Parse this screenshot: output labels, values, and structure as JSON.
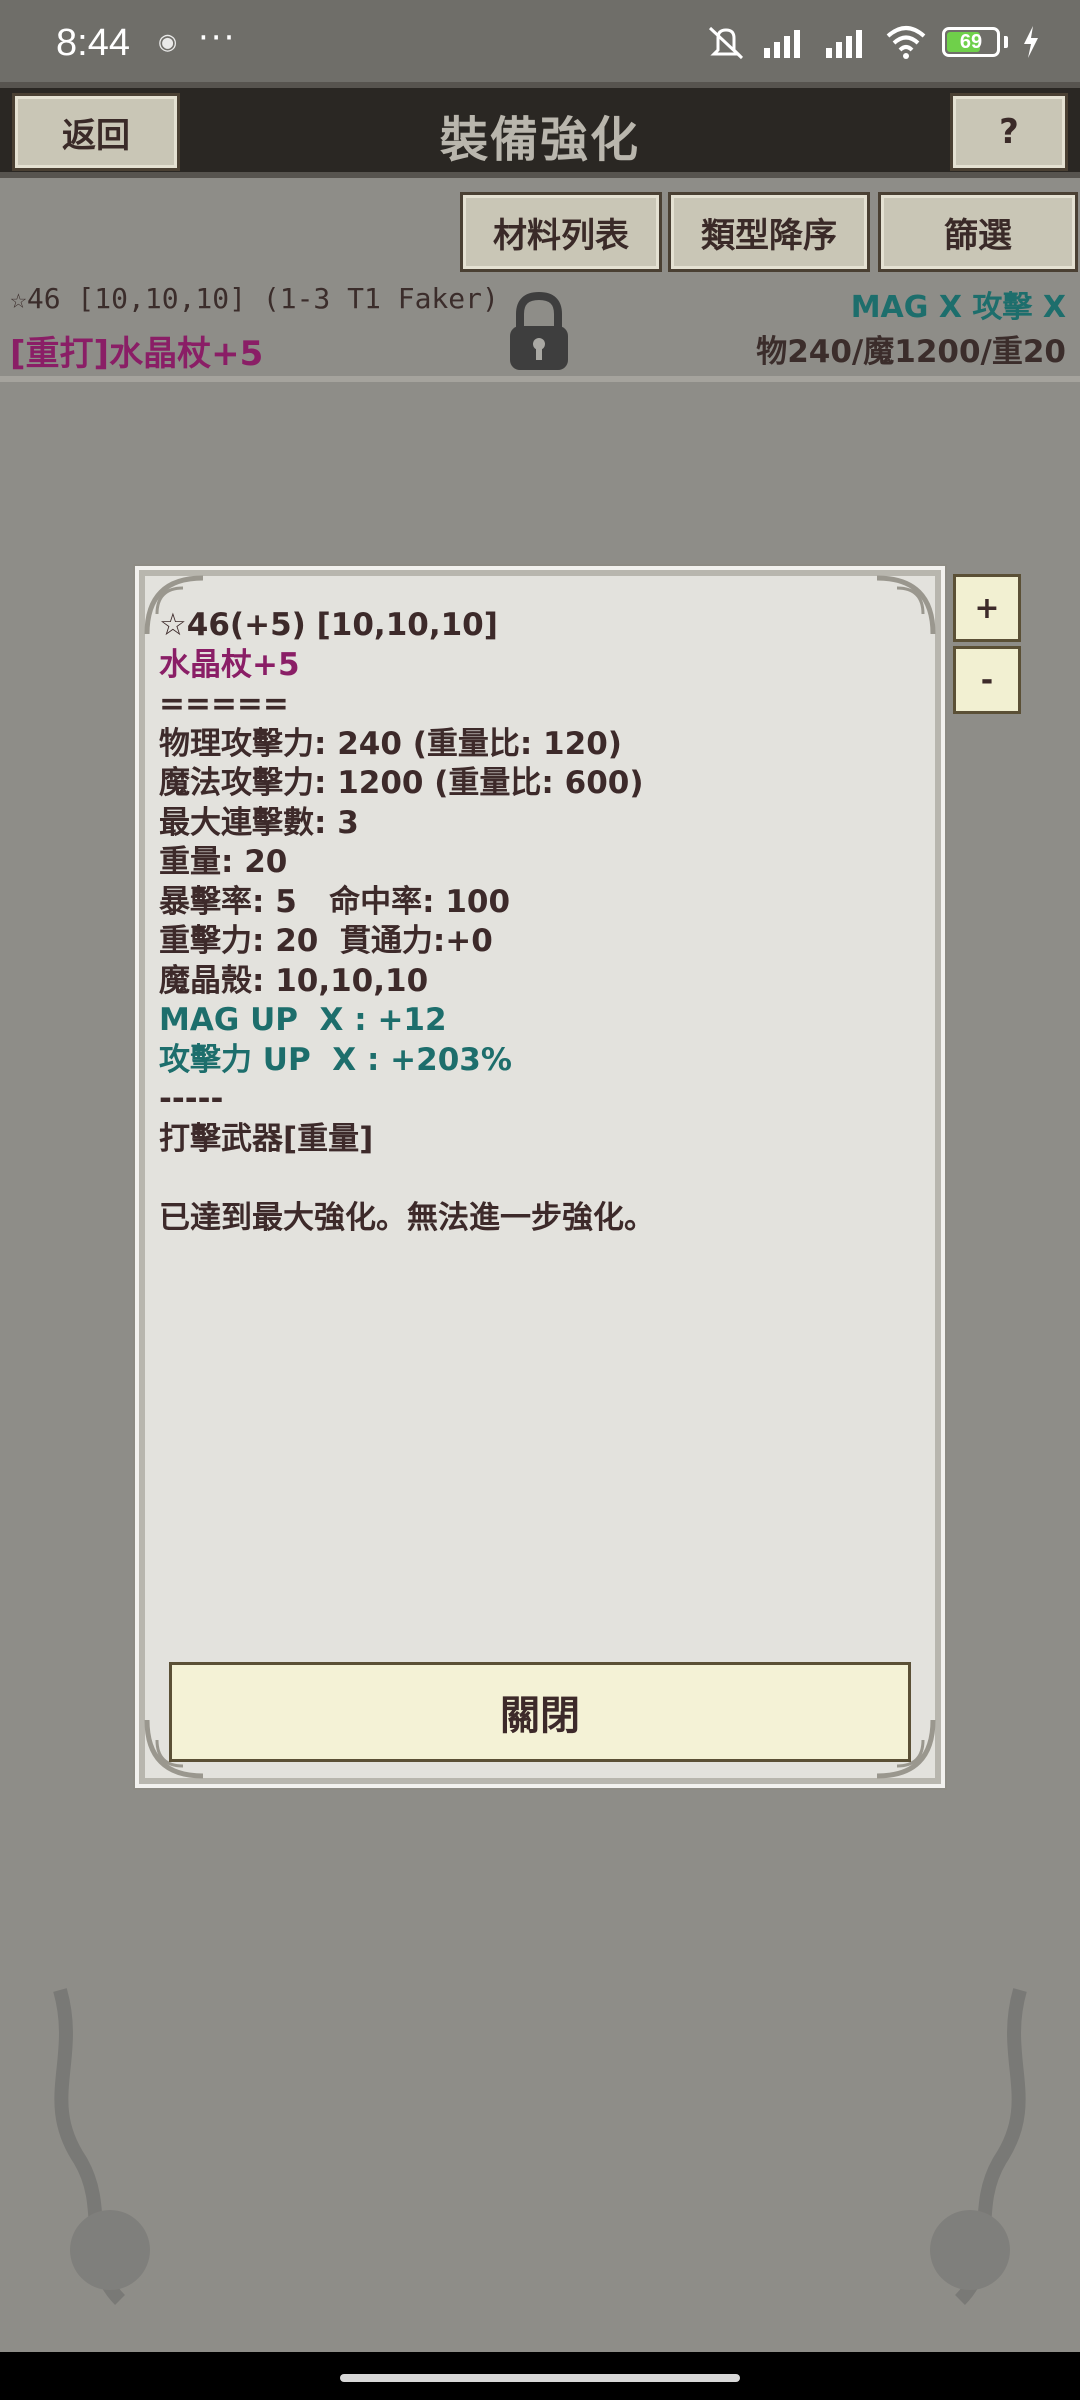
{
  "status_bar": {
    "time": "8:44",
    "misc": "◉",
    "dots": "···",
    "battery_level": "69",
    "battery_fraction": 0.69
  },
  "header": {
    "back_label": "返回",
    "title": "裝備強化",
    "help_label": "?"
  },
  "filters": {
    "materials_label": "材料列表",
    "sort_label": "類型降序",
    "filter_label": "篩選"
  },
  "item": {
    "info_line": "☆46 [10,10,10] (1-3 T1 Faker)",
    "name": "[重打]水晶杖+5",
    "bonus_tags": "MAG X  攻擊 X",
    "stats": "物240/魔1200/重20"
  },
  "dialog": {
    "lines": {
      "l0": "☆46(+5) [10,10,10]",
      "l1": "水晶杖+5",
      "l2": "=====",
      "l3": "物理攻擊力: 240 (重量比: 120)",
      "l4": "魔法攻擊力: 1200 (重量比: 600)",
      "l5": "最大連擊數: 3",
      "l6": "重量: 20",
      "l7": "暴擊率: 5   命中率: 100",
      "l8": "重擊力: 20  貫通力:+0",
      "l9": "魔晶殼: 10,10,10",
      "l10": "MAG UP  X : +12",
      "l11": "攻擊力 UP  X : +203%",
      "l12": "-----",
      "l13": "打擊武器[重量]",
      "l14": "",
      "l15": "已達到最大強化。無法進一步強化。"
    },
    "close_label": "關閉"
  },
  "side_buttons": {
    "plus": "+",
    "minus": "-"
  },
  "colors": {
    "accent_purple": "#8a1e66",
    "accent_teal": "#1d6e6c",
    "header_bg": "#2a2723",
    "page_bg": "#8e8d88"
  },
  "icons": {
    "lock": "lock-icon",
    "wifi": "wifi-icon",
    "signal": "signal-icon",
    "mute": "mute-icon",
    "charging": "charging-icon"
  }
}
